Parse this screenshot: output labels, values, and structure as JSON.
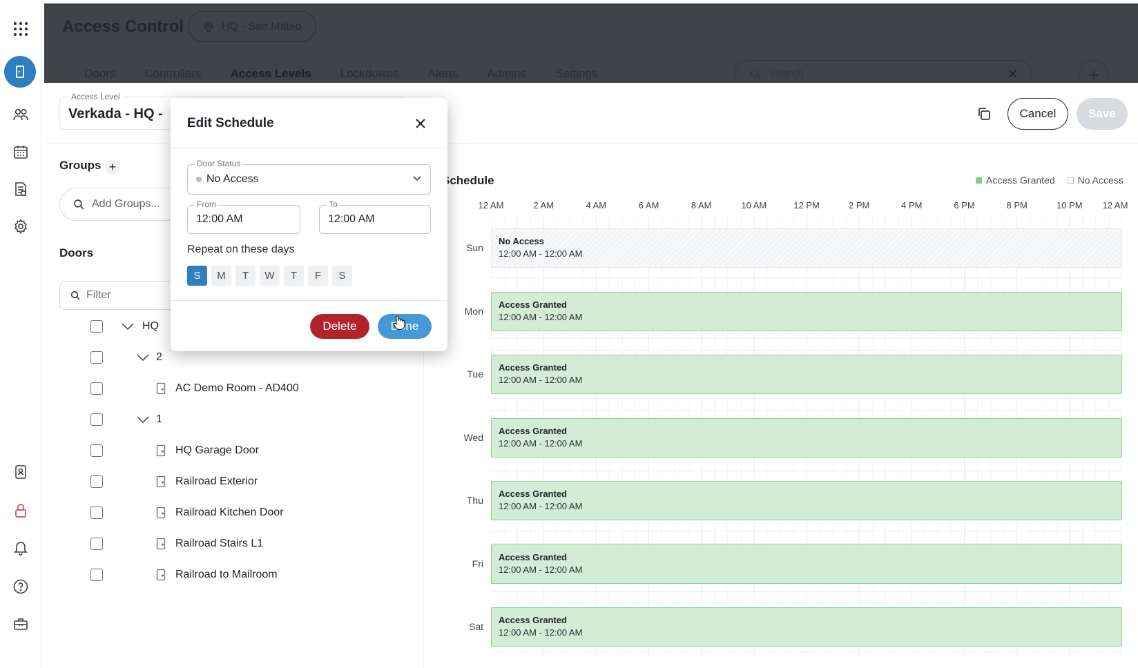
{
  "app": {
    "title": "Access Control",
    "site": "HQ - San Mateo",
    "nav_tabs": [
      "Doors",
      "Controllers",
      "Access Levels",
      "Lockdowns",
      "Alerts",
      "Admins",
      "Settings"
    ],
    "active_tab": "Access Levels",
    "search_placeholder": "Search"
  },
  "rail": {
    "icons": [
      "apps-grid-icon",
      "access-control-icon",
      "people-icon",
      "calendar-icon",
      "report-icon",
      "settings-gear-icon",
      "badge-icon",
      "lock-icon",
      "bell-icon",
      "help-icon",
      "toolbox-icon"
    ],
    "active": "access-control-icon",
    "accent": "#2f7fbf"
  },
  "access_level": {
    "label": "Access Level",
    "value": "Verkada - HQ - "
  },
  "header_actions": {
    "cancel_label": "Cancel",
    "save_label": "Save"
  },
  "groups": {
    "title": "Groups",
    "placeholder": "Add Groups..."
  },
  "doors": {
    "title": "Doors",
    "filter_placeholder": "Filter",
    "tree": [
      {
        "type": "group",
        "label": "HQ"
      },
      {
        "type": "group",
        "label": "2"
      },
      {
        "type": "door",
        "label": "AC Demo Room - AD400"
      },
      {
        "type": "group",
        "label": "1"
      },
      {
        "type": "door",
        "label": "HQ Garage Door"
      },
      {
        "type": "door",
        "label": "Railroad Exterior"
      },
      {
        "type": "door",
        "label": "Railroad Kitchen Door"
      },
      {
        "type": "door",
        "label": "Railroad Stairs L1"
      },
      {
        "type": "door",
        "label": "Railroad to Mailroom"
      }
    ]
  },
  "schedule": {
    "title": "Schedule",
    "legend": {
      "granted": "Access Granted",
      "no_access": "No Access"
    },
    "granted_color": "#d3ecd6",
    "hours": [
      "12 AM",
      "2 AM",
      "4 AM",
      "6 AM",
      "8 AM",
      "10 AM",
      "12 PM",
      "2 PM",
      "4 PM",
      "6 PM",
      "8 PM",
      "10 PM",
      "12 AM"
    ],
    "days": [
      {
        "day": "Sun",
        "status": "No Access",
        "time": "12:00 AM - 12:00 AM"
      },
      {
        "day": "Mon",
        "status": "Access Granted",
        "time": "12:00 AM - 12:00 AM"
      },
      {
        "day": "Tue",
        "status": "Access Granted",
        "time": "12:00 AM - 12:00 AM"
      },
      {
        "day": "Wed",
        "status": "Access Granted",
        "time": "12:00 AM - 12:00 AM"
      },
      {
        "day": "Thu",
        "status": "Access Granted",
        "time": "12:00 AM - 12:00 AM"
      },
      {
        "day": "Fri",
        "status": "Access Granted",
        "time": "12:00 AM - 12:00 AM"
      },
      {
        "day": "Sat",
        "status": "Access Granted",
        "time": "12:00 AM - 12:00 AM"
      }
    ]
  },
  "modal": {
    "title": "Edit Schedule",
    "door_status_label": "Door Status",
    "door_status_value": "No Access",
    "from_label": "From",
    "from_value": "12:00 AM",
    "to_label": "To",
    "to_value": "12:00 AM",
    "repeat_label": "Repeat on these days",
    "weekdays": [
      "S",
      "M",
      "T",
      "W",
      "T",
      "F",
      "S"
    ],
    "selected_days": [
      0
    ],
    "delete_label": "Delete",
    "done_label": "Done"
  }
}
